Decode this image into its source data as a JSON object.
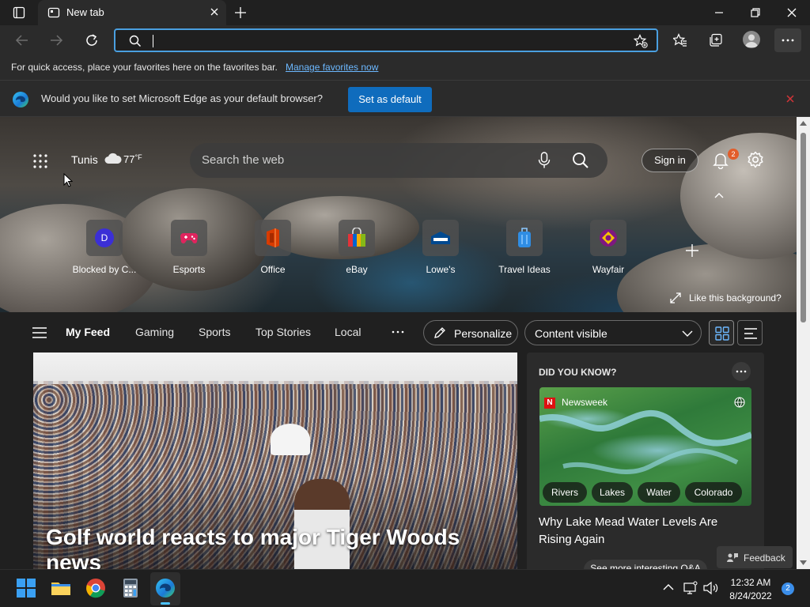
{
  "tab": {
    "title": "New tab"
  },
  "address": {
    "value": ""
  },
  "favorites_bar": {
    "message": "For quick access, place your favorites here on the favorites bar.",
    "link": "Manage favorites now"
  },
  "infobar": {
    "message": "Would you like to set Microsoft Edge as your default browser?",
    "button": "Set as default"
  },
  "weather": {
    "city": "Tunis",
    "temp": "77",
    "unit": "°F"
  },
  "search": {
    "placeholder": "Search the web"
  },
  "header": {
    "signin": "Sign in",
    "notifications": "2"
  },
  "quick_links": [
    {
      "label": "Blocked by C...",
      "icon_text": "D",
      "color": "#3b2fd6"
    },
    {
      "label": "Esports",
      "icon_text": "",
      "color": "#e0245e"
    },
    {
      "label": "Office",
      "icon_text": "",
      "color": "#d83b01"
    },
    {
      "label": "eBay",
      "icon_text": "",
      "color": "#e53238"
    },
    {
      "label": "Lowe's",
      "icon_text": "",
      "color": "#004990"
    },
    {
      "label": "Travel Ideas",
      "icon_text": "",
      "color": "#2f8de4"
    },
    {
      "label": "Wayfair",
      "icon_text": "",
      "color": "#7f187f"
    }
  ],
  "background": {
    "like": "Like this background?"
  },
  "feed": {
    "tabs": [
      "My Feed",
      "Gaming",
      "Sports",
      "Top Stories",
      "Local"
    ],
    "personalize": "Personalize",
    "content_visibility": "Content visible"
  },
  "main_story": {
    "headline": "Golf world reacts to major Tiger Woods news"
  },
  "side_card": {
    "heading": "DID YOU KNOW?",
    "source": "Newsweek",
    "chips": [
      "Rivers",
      "Lakes",
      "Water",
      "Colorado"
    ],
    "headline": "Why Lake Mead Water Levels Are Rising Again",
    "see_more": "See more interesting Q&A"
  },
  "feedback": {
    "label": "Feedback"
  },
  "taskbar": {
    "time": "12:32 AM",
    "date": "8/24/2022",
    "notifications": "2"
  }
}
